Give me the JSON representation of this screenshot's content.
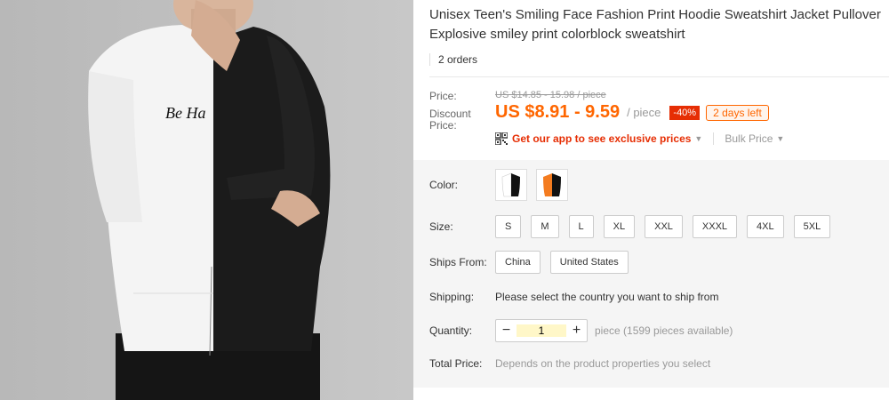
{
  "product": {
    "title": "Unisex Teen's Smiling Face Fashion Print Hoodie Sweatshirt Jacket Pullover Explosive smiley print colorblock sweatshirt",
    "orders": "2 orders",
    "hoodie_print_text": "Be Ha"
  },
  "price": {
    "label": "Price:",
    "original": "US $14.85 - 15.98 / piece",
    "discount_label": "Discount Price:",
    "discount_value": "US $8.91 - 9.59",
    "per_unit": "/ piece",
    "discount_pct": "-40%",
    "days_left": "2 days left",
    "app_promo": "Get our app to see exclusive prices",
    "bulk_price": "Bulk Price"
  },
  "options": {
    "color_label": "Color:",
    "colors": [
      {
        "name": "black-white",
        "left": "#ffffff",
        "right": "#111111"
      },
      {
        "name": "orange-black",
        "left": "#f47c20",
        "right": "#111111"
      }
    ],
    "size_label": "Size:",
    "sizes": [
      "S",
      "M",
      "L",
      "XL",
      "XXL",
      "XXXL",
      "4XL",
      "5XL"
    ],
    "ships_from_label": "Ships From:",
    "ships_from": [
      "China",
      "United States"
    ],
    "shipping_label": "Shipping:",
    "shipping_text": "Please select the country you want to ship from",
    "quantity_label": "Quantity:",
    "quantity_minus": "−",
    "quantity_value": "1",
    "quantity_plus": "+",
    "quantity_avail": "piece (1599 pieces available)",
    "total_label": "Total Price:",
    "total_text": "Depends on the product properties you select"
  },
  "colors": {
    "accent_orange": "#f60",
    "promo_red": "#e62e04",
    "panel_gray": "#f5f5f5"
  }
}
